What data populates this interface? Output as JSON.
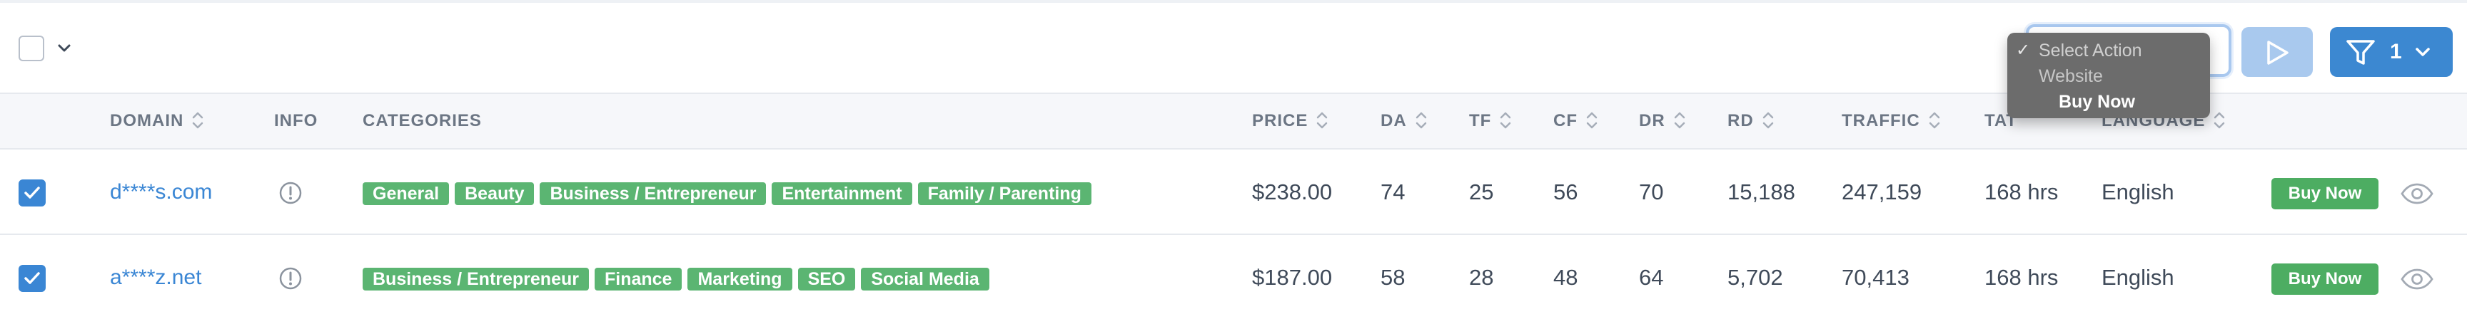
{
  "toolbar": {
    "filter_count": "1"
  },
  "action_menu": {
    "items": [
      {
        "label": "Select Action",
        "checked": true
      },
      {
        "label": "Website"
      },
      {
        "label": "Buy Now"
      }
    ]
  },
  "columns": {
    "domain": "DOMAIN",
    "info": "INFO",
    "categories": "CATEGORIES",
    "price": "PRICE",
    "da": "DA",
    "tf": "TF",
    "cf": "CF",
    "dr": "DR",
    "rd": "RD",
    "traffic": "TRAFFIC",
    "tat": "TAT",
    "language": "LANGUAGE"
  },
  "rows": [
    {
      "checked": true,
      "domain": "d****s.com",
      "categories": [
        "General",
        "Beauty",
        "Business / Entrepreneur",
        "Entertainment",
        "Family / Parenting"
      ],
      "price": "$238.00",
      "da": "74",
      "tf": "25",
      "cf": "56",
      "dr": "70",
      "rd": "15,188",
      "traffic": "247,159",
      "tat": "168 hrs",
      "language": "English",
      "action": "Buy Now"
    },
    {
      "checked": true,
      "domain": "a****z.net",
      "categories": [
        "Business / Entrepreneur",
        "Finance",
        "Marketing",
        "SEO",
        "Social Media"
      ],
      "price": "$187.00",
      "da": "58",
      "tf": "28",
      "cf": "48",
      "dr": "64",
      "rd": "5,702",
      "traffic": "70,413",
      "tat": "168 hrs",
      "language": "English",
      "action": "Buy Now"
    }
  ],
  "colors": {
    "accent": "#3a86d4",
    "tag_green": "#5bb572",
    "buy_green": "#4dad62",
    "run_disabled": "#a9c9ee",
    "dropdown_bg": "#6c6c6c"
  }
}
